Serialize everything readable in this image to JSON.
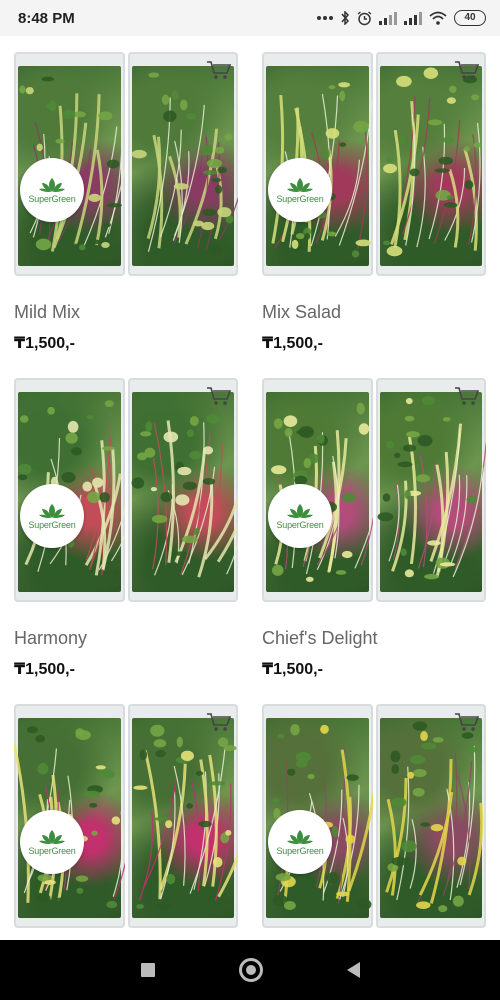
{
  "status_bar": {
    "time": "8:48 PM",
    "battery": "40",
    "icons": [
      "more-dots-icon",
      "bluetooth-icon",
      "alarm-icon",
      "signal-icon",
      "signal-icon",
      "wifi-icon",
      "battery-icon"
    ]
  },
  "brand": {
    "logo_text": "SuperGreen",
    "logo_color": "#3d8f3f"
  },
  "products": [
    {
      "name": "Mild Mix",
      "price": "₸1,500,-",
      "tint": "#4f7a3a",
      "accent": "#c8d67a",
      "pink": "#8a3b63"
    },
    {
      "name": "Mix Salad",
      "price": "₸1,500,-",
      "tint": "#557f3c",
      "accent": "#d7e07a",
      "pink": "#a13a5a"
    },
    {
      "name": "Harmony",
      "price": "₸1,500,-",
      "tint": "#3f6f33",
      "accent": "#e4e7b0",
      "pink": "#c24c58"
    },
    {
      "name": "Chief's Delight",
      "price": "₸1,500,-",
      "tint": "#4e7a35",
      "accent": "#e9ea9a",
      "pink": "#b34c7a"
    },
    {
      "name": "",
      "price": "",
      "tint": "#456f34",
      "accent": "#e6e27a",
      "pink": "#c2306e"
    },
    {
      "name": "",
      "price": "",
      "tint": "#55703a",
      "accent": "#e3d74a",
      "pink": "#8a4a62"
    }
  ]
}
